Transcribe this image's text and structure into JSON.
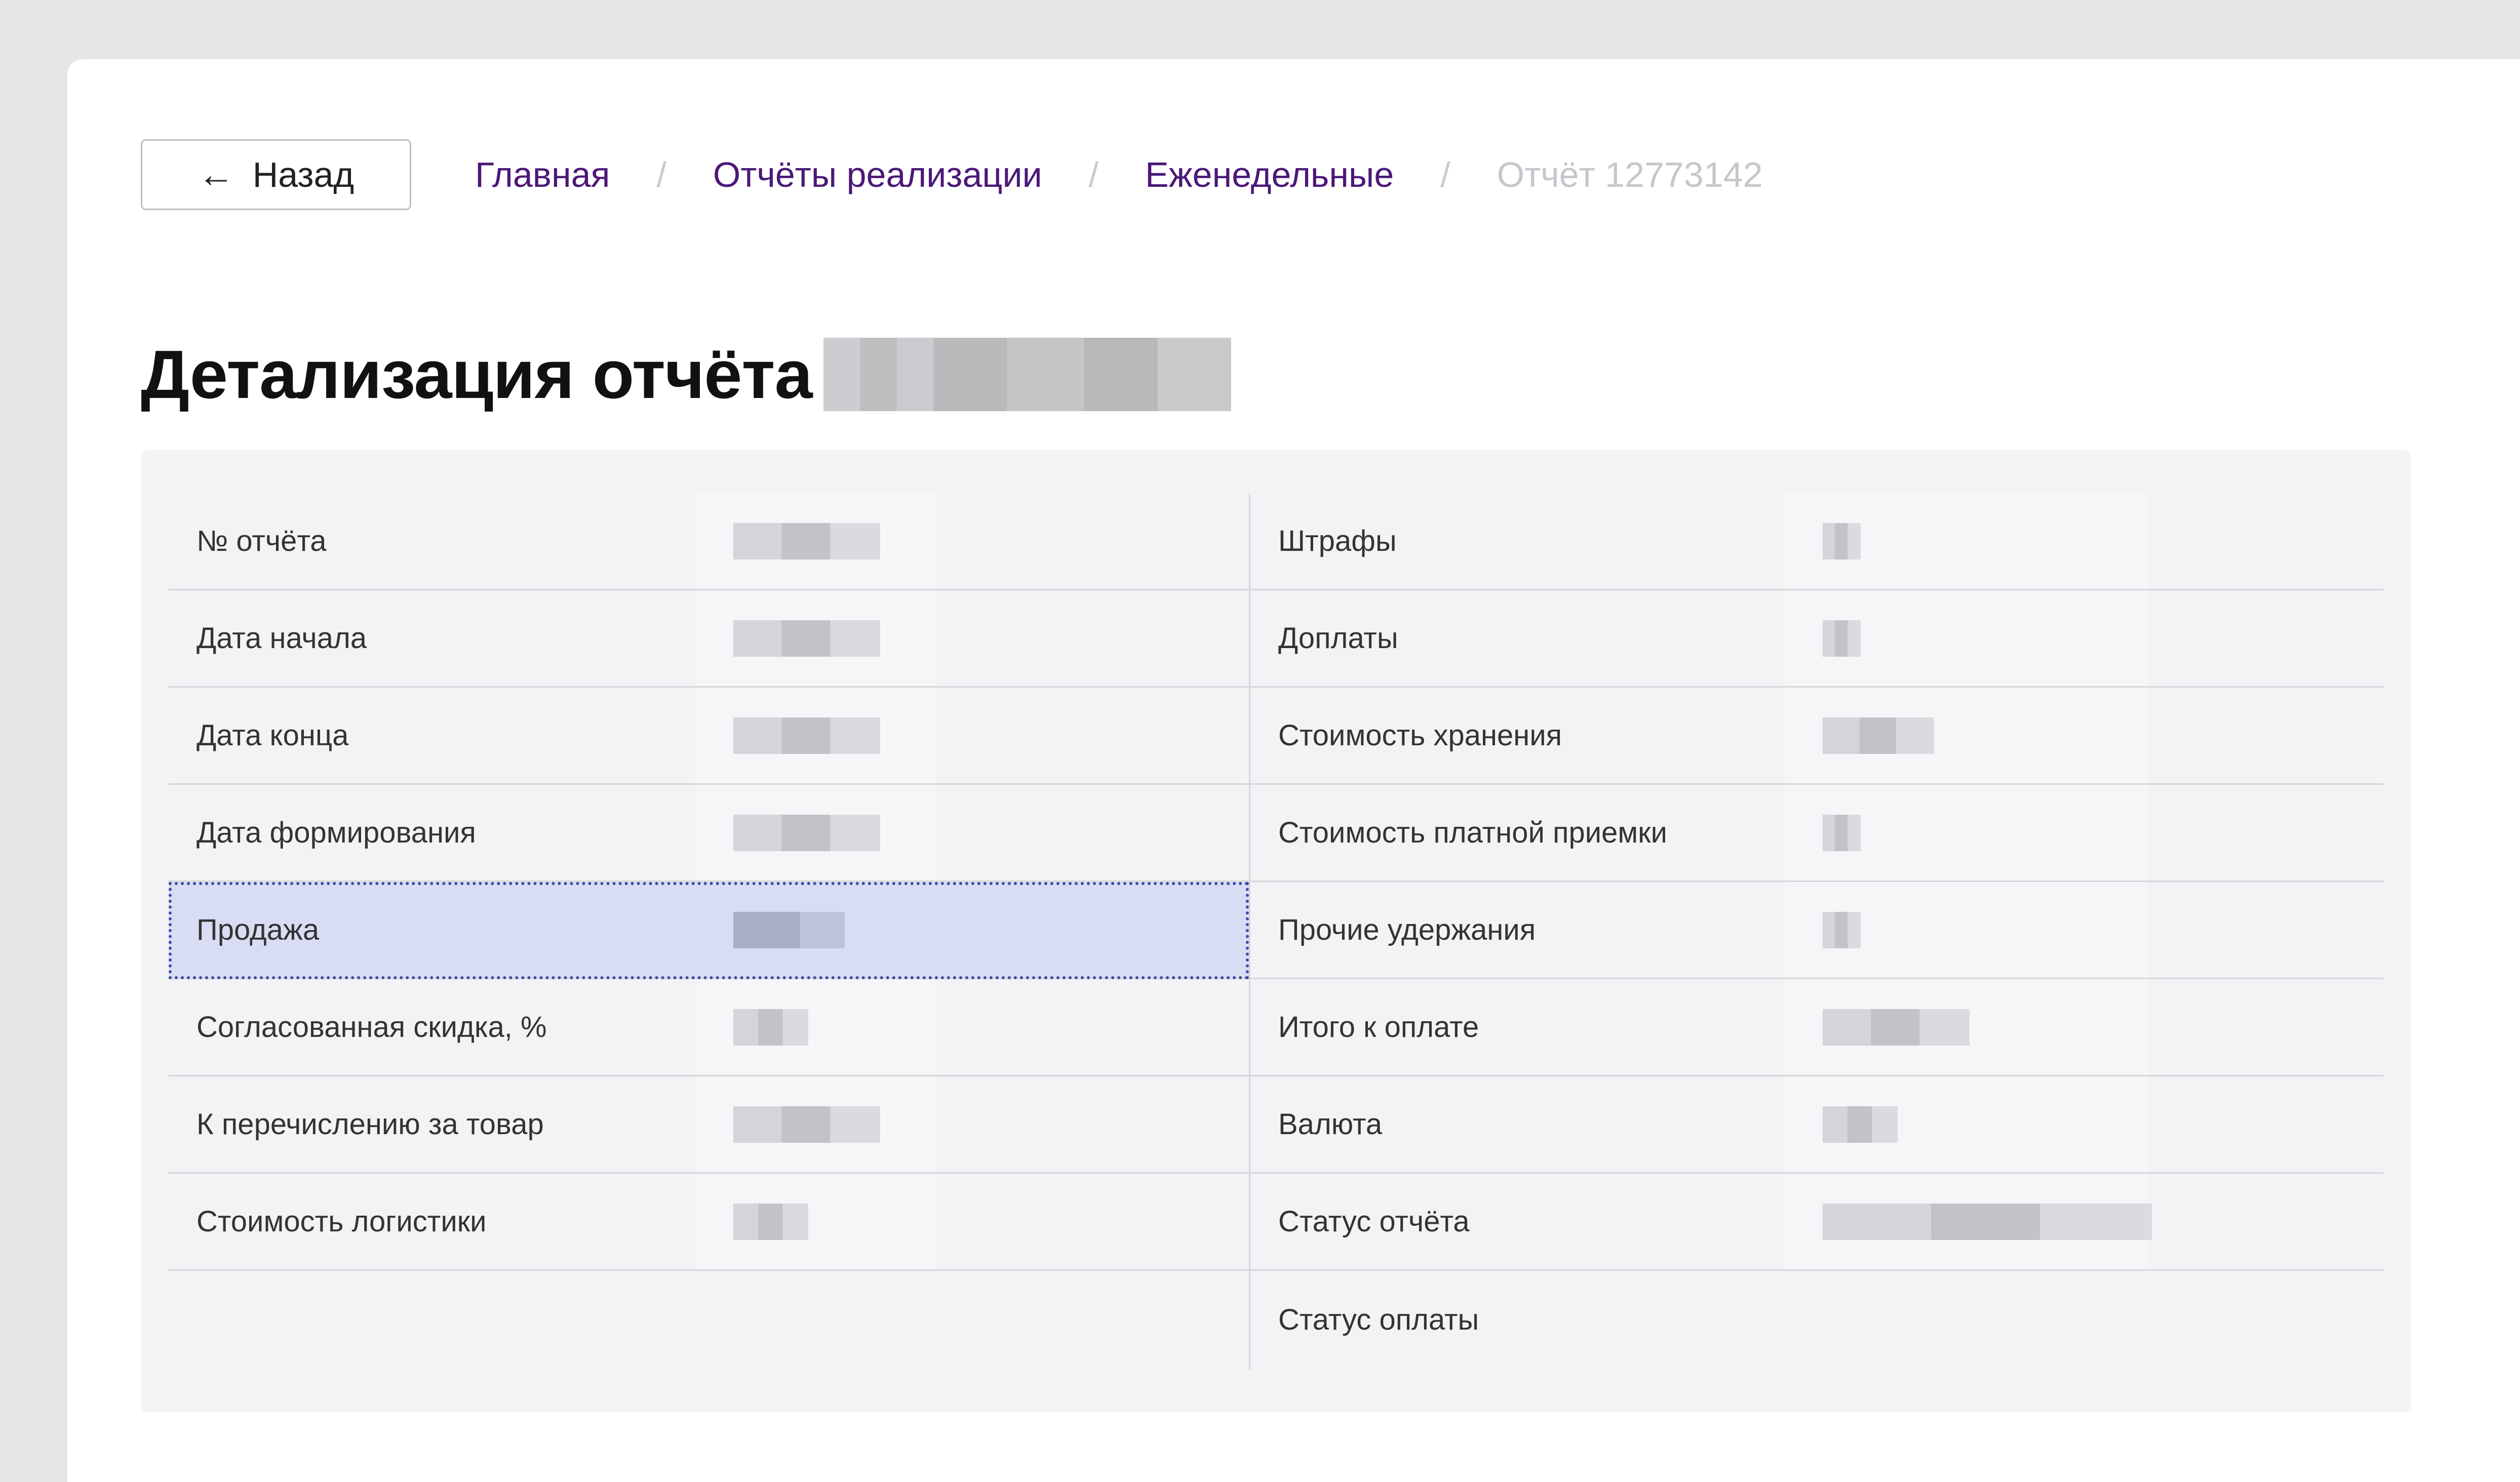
{
  "nav": {
    "back_label": "Назад",
    "breadcrumbs": [
      "Главная",
      "Отчёты реализации",
      "Еженедельные"
    ],
    "current": "Отчёт 12773142",
    "separator": "/"
  },
  "page": {
    "title": "Детализация отчёта"
  },
  "details": {
    "left": [
      {
        "label": "№ отчёта"
      },
      {
        "label": "Дата начала"
      },
      {
        "label": "Дата конца"
      },
      {
        "label": "Дата формирования"
      },
      {
        "label": "Продажа"
      },
      {
        "label": "Согласованная скидка, %"
      },
      {
        "label": "К перечислению за товар"
      },
      {
        "label": "Стоимость логистики"
      }
    ],
    "right": [
      {
        "label": "Штрафы"
      },
      {
        "label": "Доплаты"
      },
      {
        "label": "Стоимость хранения"
      },
      {
        "label": "Стоимость платной приемки"
      },
      {
        "label": "Прочие удержания"
      },
      {
        "label": "Итого к оплате"
      },
      {
        "label": "Валюта"
      },
      {
        "label": "Статус отчёта"
      },
      {
        "label": "Статус оплаты"
      }
    ]
  },
  "colors": {
    "link": "#4b1878",
    "selected_bg": "#d8ddf4",
    "selected_outline": "#3a4aa8",
    "panel_bg": "#f3f3f6"
  }
}
